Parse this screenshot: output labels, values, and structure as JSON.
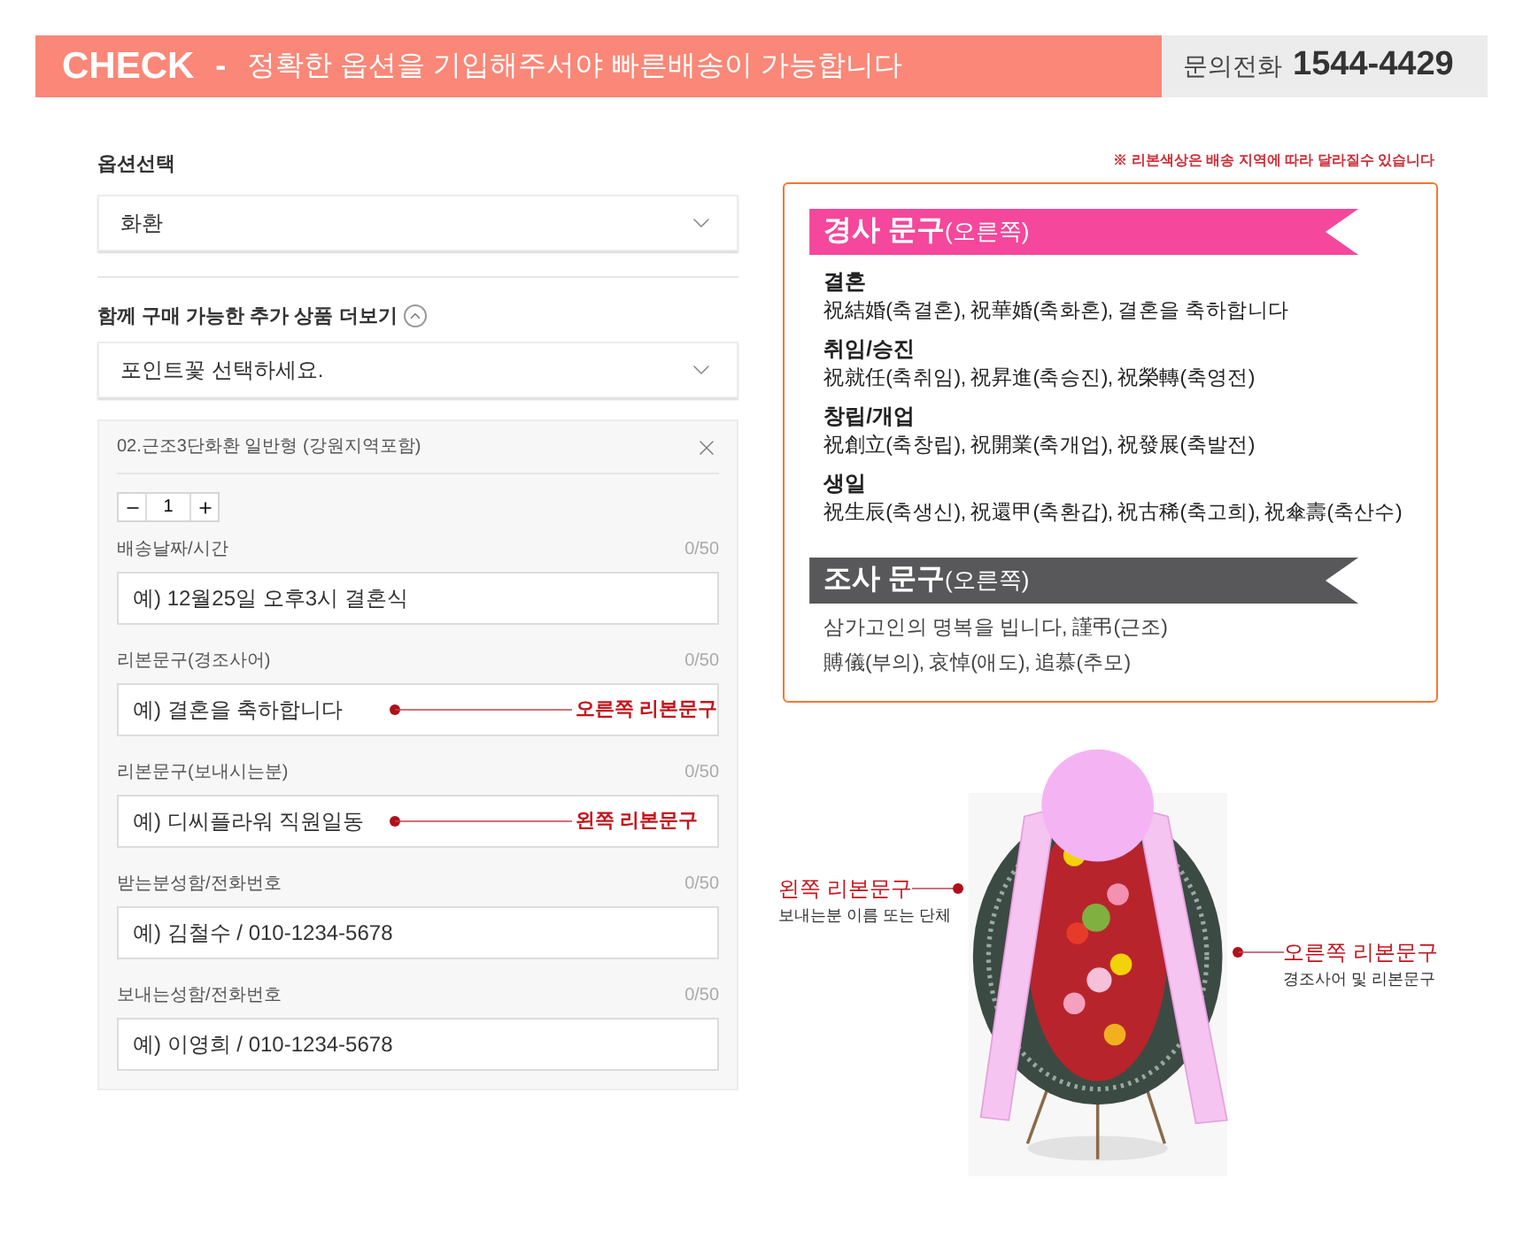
{
  "header": {
    "badge": "CHECK",
    "separator": "-",
    "message": "정확한 옵션을 기입해주서야 빠른배송이 가능합니다",
    "phone_label": "문의전화",
    "phone": "1544-4429"
  },
  "option_select": {
    "label": "옵션선택",
    "value": "화환"
  },
  "addon": {
    "label": "함께 구매 가능한 추가 상품 더보기",
    "expanded": true,
    "value": "포인트꽃 선택하세요."
  },
  "product": {
    "title": "02.근조3단화환 일반형 (강원지역포함)",
    "quantity": "1",
    "fields": [
      {
        "label": "배송날짜/시간",
        "counter": "0/50",
        "placeholder": "예) 12월25일 오후3시 결혼식"
      },
      {
        "label": "리본문구(경조사어)",
        "counter": "0/50",
        "placeholder": "예) 결혼을 축하합니다",
        "annotation": "오른쪽 리본문구"
      },
      {
        "label": "리본문구(보내시는분)",
        "counter": "0/50",
        "placeholder": "예) 디씨플라워 직원일동",
        "annotation": "왼쪽 리본문구"
      },
      {
        "label": "받는분성함/전화번호",
        "counter": "0/50",
        "placeholder": "예) 김철수 / 010-1234-5678"
      },
      {
        "label": "보내는성함/전화번호",
        "counter": "0/50",
        "placeholder": "예) 이영희 / 010-1234-5678"
      }
    ]
  },
  "notice": "※ 리본색상은 배송 지역에 따라 달라질수 있습니다",
  "phrases": [
    {
      "kind": "congratulation",
      "title": "경사 문구",
      "suffix": "(오른쪽)",
      "groups": [
        {
          "heading": "결혼",
          "text": "祝結婚(축결혼), 祝華婚(축화혼), 결혼을 축하합니다"
        },
        {
          "heading": "취임/승진",
          "text": "祝就任(축취임), 祝昇進(축승진), 祝榮轉(축영전)"
        },
        {
          "heading": "창립/개업",
          "text": "祝創立(축창립), 祝開業(축개업), 祝發展(축발전)"
        },
        {
          "heading": "생일",
          "text": "祝生辰(축생신), 祝還甲(축환갑), 祝古稀(축고희), 祝傘壽(축산수)"
        }
      ]
    },
    {
      "kind": "condolence",
      "title": "조사 문구",
      "suffix": "(오른쪽)",
      "groups": [
        {
          "text": "삼가고인의 명복을 빕니다, 謹弔(근조)"
        },
        {
          "text": "賻儀(부의), 哀悼(애도), 追慕(추모)"
        }
      ]
    }
  ],
  "diagram": {
    "labels": [
      {
        "kind": "left",
        "title": "왼쪽 리본문구",
        "caption": "보내는분 이름 또는 단체"
      },
      {
        "kind": "right",
        "title": "오른쪽 리본문구",
        "caption": "경조사어 및 리본문구"
      }
    ]
  }
}
